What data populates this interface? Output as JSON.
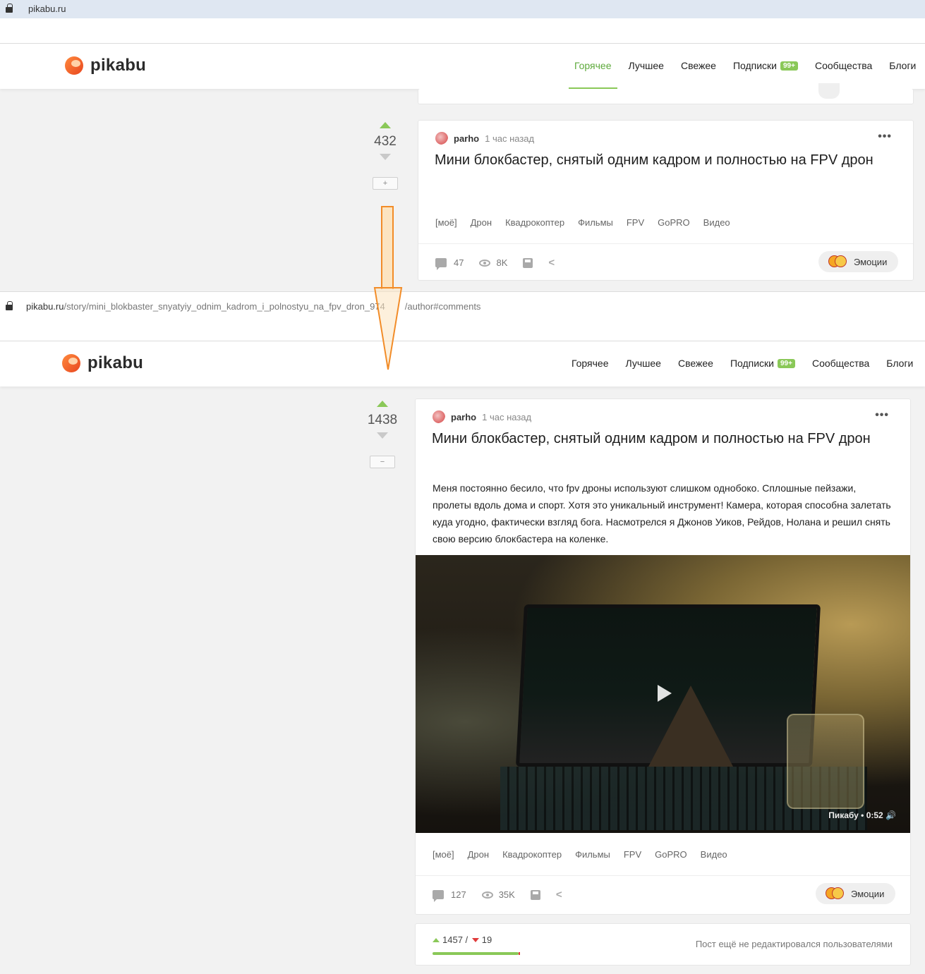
{
  "browser_top": {
    "url_host": "pikabu.ru",
    "url_path": ""
  },
  "browser_bottom": {
    "url_host": "pikabu.ru",
    "url_path": "/story/mini_blokbaster_snyatyiy_odnim_kadrom_i_polnostyu_na_fpv_dron_974",
    "url_tail": "/author#comments"
  },
  "brand": {
    "name": "pikabu",
    "accent": "#8ac858",
    "orange": "#f28c28"
  },
  "nav": {
    "items": [
      {
        "label": "Горячее"
      },
      {
        "label": "Лучшее"
      },
      {
        "label": "Свежее"
      },
      {
        "label": "Подписки",
        "badge": "99+"
      },
      {
        "label": "Сообщества"
      },
      {
        "label": "Блоги"
      }
    ]
  },
  "top_post": {
    "rating": "432",
    "toggle": "+",
    "author": "parho",
    "time": "1 час назад",
    "menu": "•••",
    "title": "Мини блокбастер, снятый одним кадром и полностью на FPV дрон",
    "tags": [
      "[моё]",
      "Дрон",
      "Квадрокоптер",
      "Фильмы",
      "FPV",
      "GoPRO",
      "Видео"
    ],
    "comments": "47",
    "views": "8K",
    "emotions_label": "Эмоции"
  },
  "bottom_post": {
    "rating": "1438",
    "toggle": "−",
    "author": "parho",
    "time": "1 час назад",
    "menu": "•••",
    "title": "Мини блокбастер, снятый одним кадром и полностью на FPV дрон",
    "body": "Меня постоянно бесило, что fpv дроны используют слишком однобоко. Сплошные пейзажи, пролеты вдоль дома и спорт. Хотя это уникальный инструмент! Камера, которая способна залетать куда угодно, фактически взгляд бога. Насмотрелся я Джонов Уиков, Рейдов, Нолана и решил снять свою версию блокбастера на коленке.",
    "video": {
      "meta": "Пикабу • 0:52 🔊"
    },
    "tags": [
      "[моё]",
      "Дрон",
      "Квадрокоптер",
      "Фильмы",
      "FPV",
      "GoPRO",
      "Видео"
    ],
    "comments": "127",
    "views": "35K",
    "emotions_label": "Эмоции",
    "pluses": "1457",
    "separator": " / ",
    "minuses": "19",
    "plus_fraction": 0.987,
    "edit_note": "Пост ещё не редактировался пользователями"
  }
}
